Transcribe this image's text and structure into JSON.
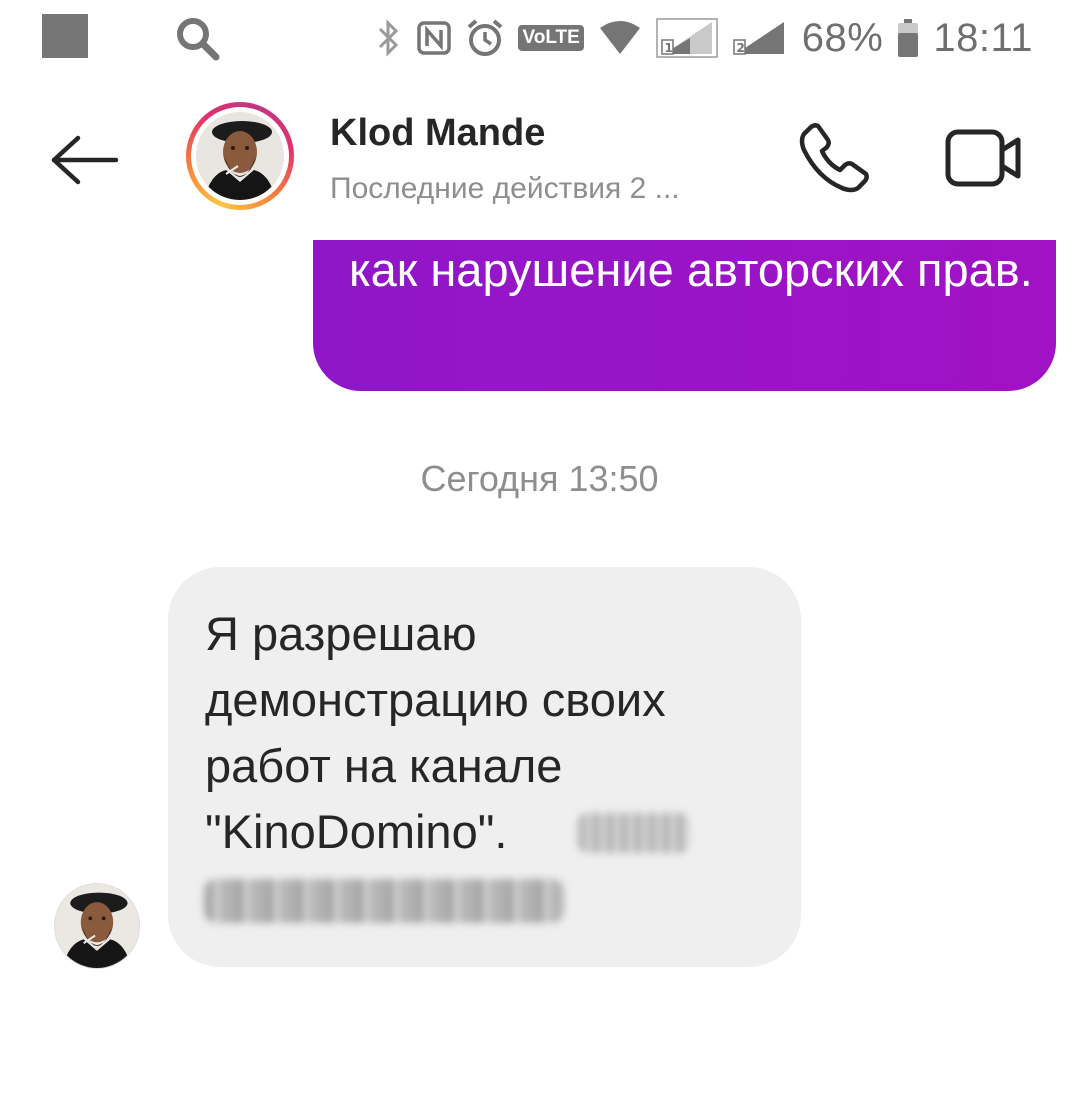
{
  "status_bar": {
    "battery_percent": "68%",
    "time": "18:11",
    "volte_label": "VoLTE",
    "icons": [
      "notification-square-icon",
      "search-icon",
      "bluetooth-icon",
      "nfc-icon",
      "alarm-icon",
      "volte-icon",
      "wifi-icon",
      "signal-sim1-icon",
      "signal-sim2-icon",
      "battery-icon"
    ]
  },
  "header": {
    "contact_name": "Klod Mande",
    "activity_status": "Последние действия 2 ..."
  },
  "messages": {
    "outgoing": {
      "text": "как нарушение авторских прав."
    },
    "day_timestamp": "Сегодня 13:50",
    "incoming": {
      "text": "Я разрешаю демонстрацию своих работ на канале \"KinoDomino\"."
    }
  },
  "colors": {
    "outgoing_bubble": "#9a14c6",
    "incoming_bubble": "#efefef",
    "text_primary": "#262626",
    "text_secondary": "#8e8e8e"
  }
}
